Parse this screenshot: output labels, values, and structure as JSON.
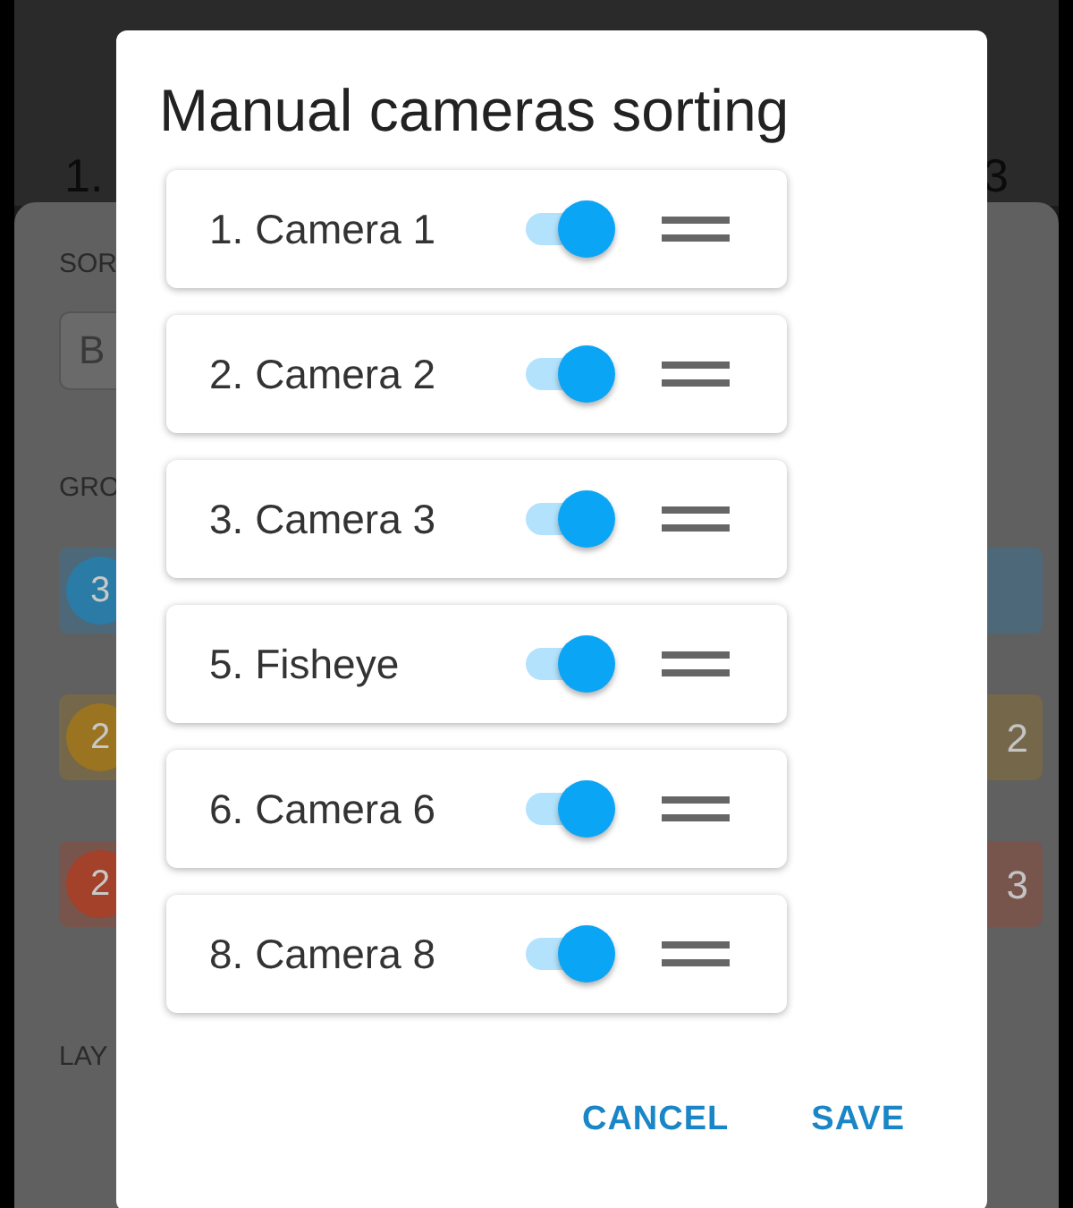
{
  "background": {
    "thumbnails": [
      {
        "label": "1."
      },
      {
        "label": "3"
      }
    ],
    "sort_heading": "SOR",
    "sort_field": "B",
    "group_heading": "GRO",
    "groups": [
      {
        "badge": "3",
        "color": "#2a7ba6"
      },
      {
        "badge": "2",
        "color": "#9a7420",
        "count": "2"
      },
      {
        "badge": "2",
        "color": "#a3412a",
        "count": "3"
      }
    ],
    "layout_heading": "LAY"
  },
  "dialog": {
    "title": "Manual cameras sorting",
    "cameras": [
      {
        "label": "1. Camera 1",
        "on": true
      },
      {
        "label": "2. Camera 2",
        "on": true
      },
      {
        "label": "3. Camera 3",
        "on": true
      },
      {
        "label": "5. Fisheye",
        "on": true
      },
      {
        "label": "6. Camera 6",
        "on": true
      },
      {
        "label": "8. Camera 8",
        "on": true
      }
    ],
    "buttons": [
      "CANCEL",
      "SAVE"
    ]
  }
}
